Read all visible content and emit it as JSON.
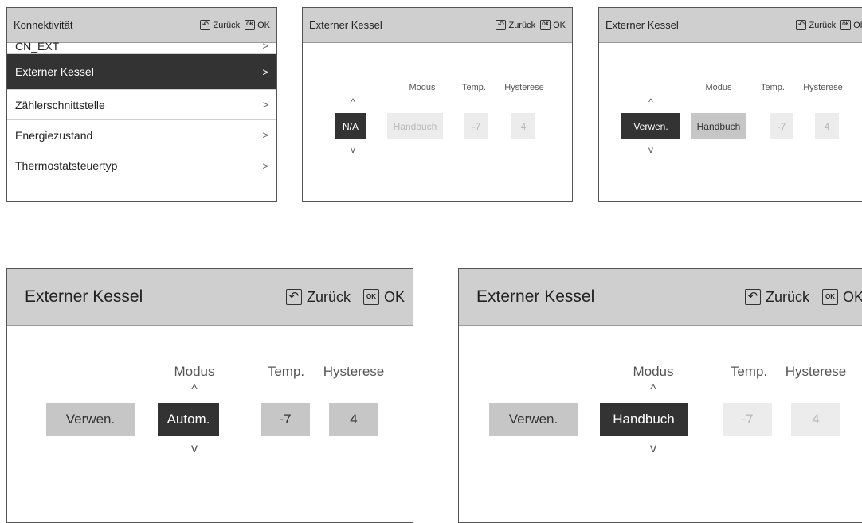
{
  "back_label": "Zurück",
  "ok_label": "OK",
  "ok_icon_text": "OK",
  "menu": {
    "title": "Konnektivität",
    "items": [
      {
        "label": "CN_EXT",
        "chevron": ">"
      },
      {
        "label": "Externer Kessel",
        "chevron": ">"
      },
      {
        "label": "Zählerschnittstelle",
        "chevron": ">"
      },
      {
        "label": "Energiezustand",
        "chevron": ">"
      },
      {
        "label": "Thermostatsteuertyp",
        "chevron": ">"
      }
    ]
  },
  "kessel": {
    "title": "Externer Kessel",
    "labels": {
      "modus": "Modus",
      "temp": "Temp.",
      "hysterese": "Hysterese"
    },
    "caret_up": "^",
    "caret_down": "v"
  },
  "screen_na": {
    "use": "N/A",
    "mode": "Handbuch",
    "temp": "-7",
    "hyst": "4"
  },
  "screen_use": {
    "use": "Verwen.",
    "mode": "Handbuch",
    "temp": "-7",
    "hyst": "4"
  },
  "screen_auto": {
    "use": "Verwen.",
    "mode": "Autom.",
    "temp": "-7",
    "hyst": "4"
  },
  "screen_manual": {
    "use": "Verwen.",
    "mode": "Handbuch",
    "temp": "-7",
    "hyst": "4"
  }
}
